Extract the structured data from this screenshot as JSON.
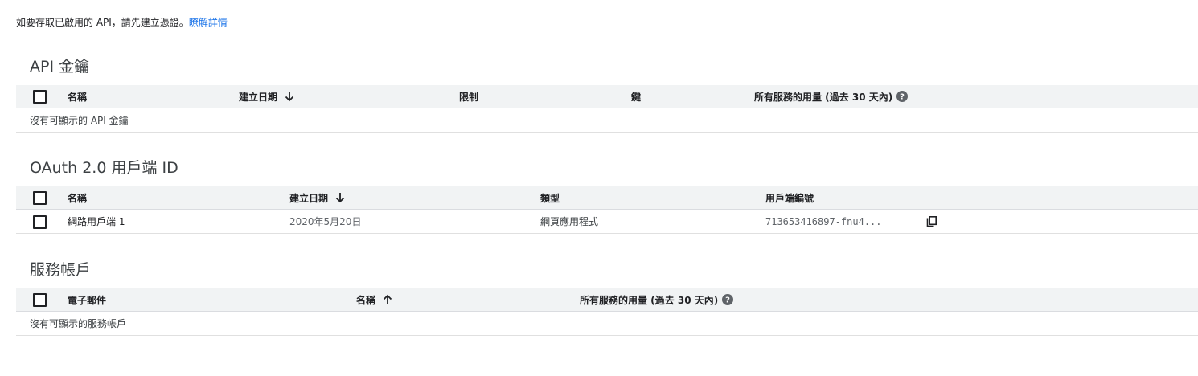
{
  "intro": {
    "text": "如要存取已啟用的 API，請先建立憑證。",
    "link": "瞭解詳情"
  },
  "api_keys": {
    "title": "API 金鑰",
    "columns": {
      "name": "名稱",
      "created": "建立日期",
      "restrictions": "限制",
      "key": "鍵",
      "usage": "所有服務的用量 (過去 30 天內)"
    },
    "empty": "沒有可顯示的 API 金鑰"
  },
  "oauth": {
    "title": "OAuth 2.0 用戶端 ID",
    "columns": {
      "name": "名稱",
      "created": "建立日期",
      "type": "類型",
      "client_id": "用戶端編號"
    },
    "rows": [
      {
        "name": "網路用戶端 1",
        "created": "2020年5月20日",
        "type": "網頁應用程式",
        "client_id": "713653416897-fnu4..."
      }
    ]
  },
  "service_accounts": {
    "title": "服務帳戶",
    "columns": {
      "email": "電子郵件",
      "name": "名稱",
      "usage": "所有服務的用量 (過去 30 天內)"
    },
    "empty": "沒有可顯示的服務帳戶"
  },
  "icons": {
    "sort_desc": "arrow-down-icon",
    "sort_asc": "arrow-up-icon",
    "help": "help-circle-icon",
    "copy": "copy-icon"
  }
}
